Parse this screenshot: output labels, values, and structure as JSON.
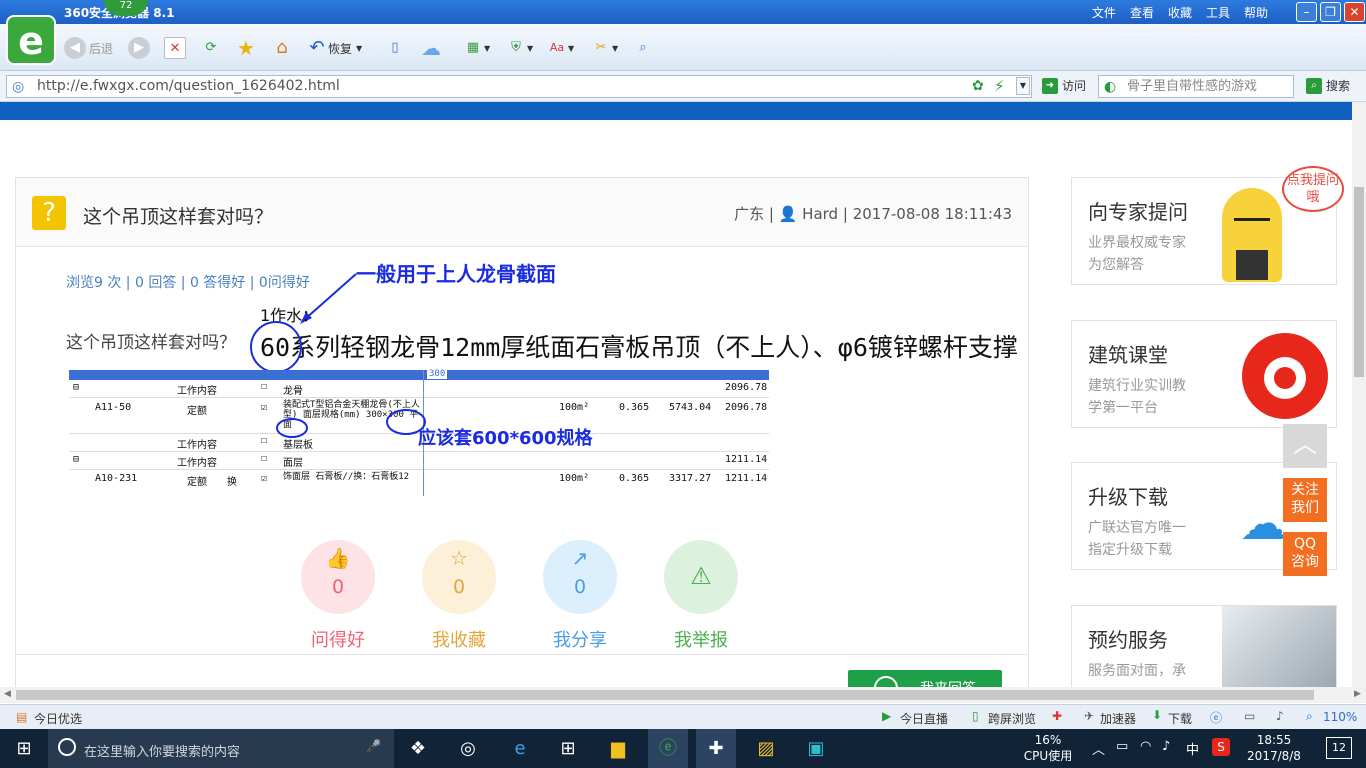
{
  "browser": {
    "title": "360安全浏览器 8.1",
    "badge": "72",
    "menus": [
      "文件",
      "查看",
      "收藏",
      "工具",
      "帮助"
    ],
    "toolbar": {
      "back": "后退",
      "restore": "恢复"
    },
    "url": "http://e.fwxgx.com/question_1626402.html",
    "visit": "访问",
    "search_placeholder": "骨子里自带性感的游戏",
    "search_btn": "搜索"
  },
  "question": {
    "title": "这个吊顶这样套对吗？",
    "region": "广东",
    "user": "Hard",
    "datetime": "2017-08-08 18:11:43",
    "stats": "浏览9 次 | 0 回答 | 0 答得好 | 0问得好",
    "body": "这个吊顶这样套对吗？",
    "hand_note1": "一般用于上人龙骨截面",
    "sketch_top": "1作水：",
    "sketch_text": "60系列轻钢龙骨12mm厚纸面石膏板吊顶（不上人）、φ6镀锌螺杆支撑",
    "hand_note2": "应该套600*600规格",
    "table": {
      "rows": [
        {
          "col1": "",
          "col2": "工作内容",
          "col3": "",
          "check": "☐",
          "desc": "龙骨",
          "unit": "",
          "qty": "",
          "price": "",
          "total": "2096.78"
        },
        {
          "col1": "A11-50",
          "col2": "定额",
          "col3": "",
          "check": "☑",
          "desc": "装配式T型铝合金天棚龙骨(不上人型) 面层规格(mm) 300×300 平面",
          "unit": "100m²",
          "qty": "0.365",
          "price": "5743.04",
          "total": "2096.78"
        },
        {
          "col1": "",
          "col2": "工作内容",
          "col3": "",
          "check": "☐",
          "desc": "基层板",
          "unit": "",
          "qty": "",
          "price": "",
          "total": ""
        },
        {
          "col1": "",
          "col2": "工作内容",
          "col3": "",
          "check": "☐",
          "desc": "面层",
          "unit": "",
          "qty": "",
          "price": "",
          "total": "1211.14"
        },
        {
          "col1": "A10-231",
          "col2": "定额",
          "col3": "换",
          "check": "☑",
          "desc": "饰面层 石膏板//换：石膏板12",
          "unit": "100m²",
          "qty": "0.365",
          "price": "3317.27",
          "total": "1211.14"
        }
      ],
      "header_cell": "300"
    },
    "actions": [
      {
        "label": "问得好",
        "count": "0",
        "icon": "👍"
      },
      {
        "label": "我收藏",
        "count": "0",
        "icon": "☆"
      },
      {
        "label": "我分享",
        "count": "0",
        "icon": "↗"
      },
      {
        "label": "我举报",
        "count": "",
        "icon": "⚠"
      }
    ],
    "answer_btn": "我来回答"
  },
  "sidebar": [
    {
      "title": "向专家提问",
      "desc1": "业界最权威专家",
      "desc2": "为您解答",
      "bubble": "点我提问哦"
    },
    {
      "title": "建筑课堂",
      "desc1": "建筑行业实训教",
      "desc2": "学第一平台"
    },
    {
      "title": "升级下载",
      "desc1": "广联达官方唯一",
      "desc2": "指定升级下载"
    },
    {
      "title": "预约服务",
      "desc1": "服务面对面，承",
      "desc2": ""
    }
  ],
  "float": {
    "follow": "关注我们",
    "qq": "QQ咨询"
  },
  "status": {
    "left": "今日优选",
    "live": "今日直播",
    "cross": "跨屏浏览",
    "accel": "加速器",
    "download": "下载",
    "zoom": "110%"
  },
  "taskbar": {
    "search": "在这里输入你要搜索的内容",
    "cpu_pct": "16%",
    "cpu_label": "CPU使用",
    "ime": "中",
    "time": "18:55",
    "date": "2017/8/8",
    "notif": "12"
  },
  "colors": {
    "accent": "#0f5fbe",
    "green": "#1ea04b",
    "orange": "#f26f21",
    "pink": "#f26277",
    "yellow": "#e5a53a",
    "blue": "#4a9de0",
    "greenl": "#4caf50"
  }
}
